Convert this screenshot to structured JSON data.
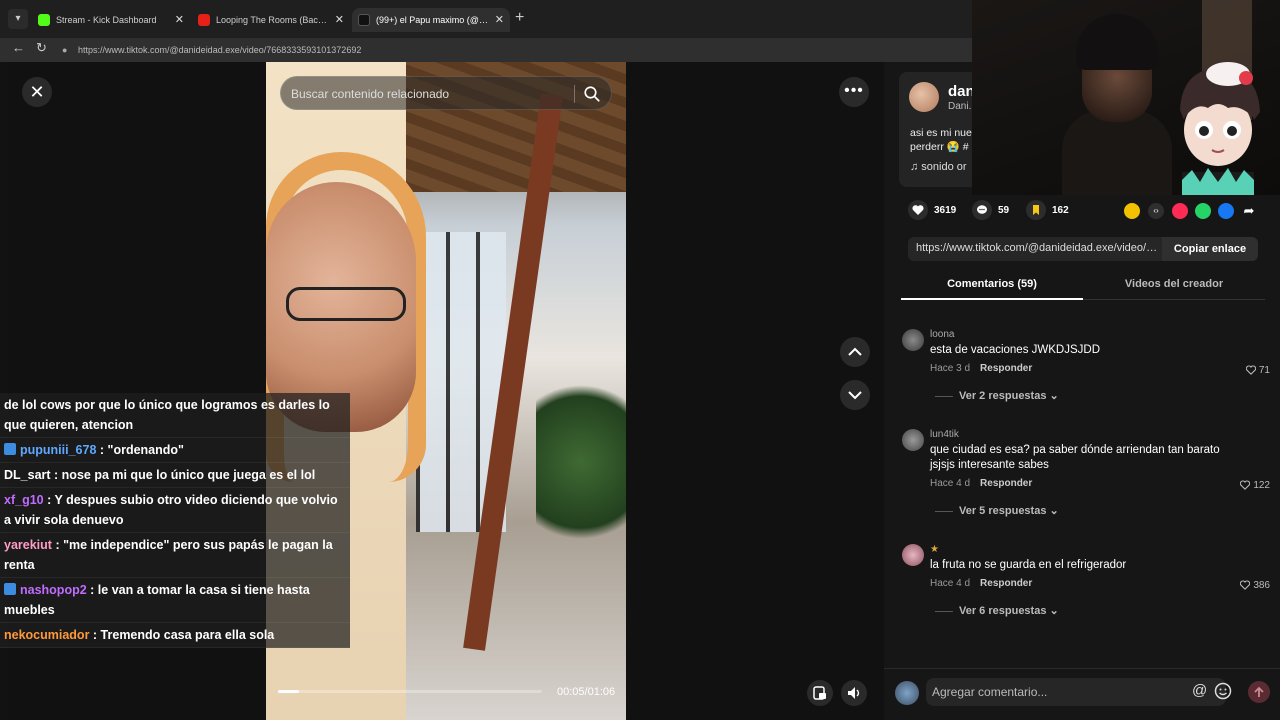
{
  "browser": {
    "tabs": [
      {
        "label": "Stream - Kick Dashboard",
        "color": "#53fc18"
      },
      {
        "label": "Looping The Rooms (Backrooms U",
        "color": "#e62117"
      },
      {
        "label": "(99+) el Papu maximo (@xys1",
        "color": "#ffffff"
      }
    ],
    "url": "https://www.tiktok.com/@danideidad.exe/video/7668333593101372692"
  },
  "player": {
    "search_placeholder": "Buscar contenido relacionado",
    "time": "00:05/01:06",
    "progress": 0.08
  },
  "chat": [
    {
      "user": "",
      "text": "de lol cows por que lo único que logramos es darles lo que quieren, atencion",
      "color": "#ffffff",
      "icon": ""
    },
    {
      "user": "pupuniii_678",
      "text": ": \"ordenando\"",
      "color": "#5ea8ff",
      "icon": "#3c8de0"
    },
    {
      "user": "DL_sart",
      "text": ": nose pa mi que lo único que juega es el lol",
      "color": "#ffffff",
      "icon": ""
    },
    {
      "user": "xf_g10",
      "text": ": Y despues subio otro video diciendo que volvio a vivir sola denuevo",
      "color": "#c06cff",
      "icon": ""
    },
    {
      "user": "yarekiut",
      "text": ": \"me independice\" pero sus papás le pagan la renta",
      "color": "#ff9dc6",
      "icon": ""
    },
    {
      "user": "nashopop2",
      "text": ": le van a tomar la casa si tiene hasta muebles",
      "color": "#c06cff",
      "icon": "#3c8de0"
    },
    {
      "user": "nekocumiador",
      "text": ": Tremendo casa para ella sola",
      "color": "#ff9a3c",
      "icon": ""
    }
  ],
  "author": {
    "name": "dan",
    "sub": "Dani.",
    "desc_line1": "asi es mi nue",
    "desc_line2": "perderr 😭 #",
    "sound": "♫  sonido or"
  },
  "stats": {
    "likes": "3619",
    "comments": "59",
    "saves": "162"
  },
  "share_colors": [
    "#f2c200",
    "#2e2e2e",
    "#fe2c55",
    "#25d366",
    "#1877f2",
    "#2e2e2e"
  ],
  "link": {
    "text": "https://www.tiktok.com/@danideidad.exe/video/7...",
    "copy_label": "Copiar enlace"
  },
  "tabs": {
    "comments": "Comentarios (59)",
    "creator": "Videos del creador"
  },
  "comments": [
    {
      "user": "loona",
      "text": "esta de vacaciones JWKDJSJDD",
      "time": "Hace 3 d",
      "reply": "Responder",
      "likes": "71",
      "replies": "Ver 2 respuestas"
    },
    {
      "user": "lun4tik",
      "text": "que ciudad es esa? pa saber dónde arriendan tan barato jsjsjs interesante sabes",
      "time": "Hace 4 d",
      "reply": "Responder",
      "likes": "122",
      "replies": "Ver 5 respuestas"
    },
    {
      "user": "★",
      "text": "la fruta no se guarda en el refrigerador",
      "time": "Hace 4 d",
      "reply": "Responder",
      "likes": "386",
      "replies": "Ver 6 respuestas"
    }
  ],
  "comment_bar": {
    "placeholder": "Agregar comentario...",
    "at": "@"
  }
}
